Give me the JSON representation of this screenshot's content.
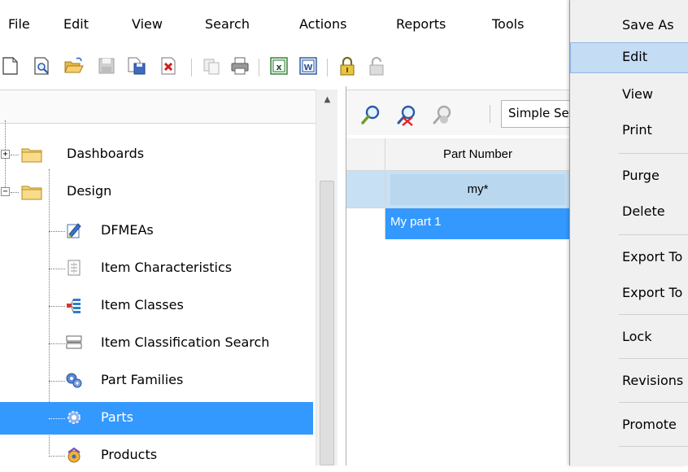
{
  "menubar": {
    "items": [
      "File",
      "Edit",
      "View",
      "Search",
      "Actions",
      "Reports",
      "Tools"
    ]
  },
  "toolbar": {
    "buttons": [
      "new-doc-icon",
      "print-preview-icon",
      "open-folder-icon",
      "save-icon",
      "save-as-icon",
      "delete-icon",
      "copy-icon",
      "print-icon",
      "excel-icon",
      "word-icon",
      "lock-icon",
      "unlock-icon"
    ]
  },
  "tree": {
    "items": [
      {
        "label": "Dashboards",
        "type": "folder",
        "expander": "+"
      },
      {
        "label": "Design",
        "type": "folder",
        "expander": "−"
      },
      {
        "label": "DFMEAs",
        "type": "leaf",
        "icon": "dfmea-icon"
      },
      {
        "label": "Item Characteristics",
        "type": "leaf",
        "icon": "characteristics-icon"
      },
      {
        "label": "Item Classes",
        "type": "leaf",
        "icon": "item-classes-icon"
      },
      {
        "label": "Item Classification Search",
        "type": "leaf",
        "icon": "classification-icon"
      },
      {
        "label": "Part Families",
        "type": "leaf",
        "icon": "part-families-icon"
      },
      {
        "label": "Parts",
        "type": "leaf",
        "icon": "parts-gear-icon",
        "selected": true
      },
      {
        "label": "Products",
        "type": "leaf",
        "icon": "products-icon"
      }
    ]
  },
  "grid": {
    "search_mode": "Simple Search",
    "column_header": "Part Number",
    "filter_value": "my*",
    "rows": [
      "My part 1"
    ]
  },
  "context_menu": {
    "items": [
      "Save As",
      "Edit",
      "View",
      "Print",
      "Purge",
      "Delete",
      "Export To",
      "Export To",
      "Lock",
      "Revisions",
      "Promote"
    ],
    "highlighted": "Edit"
  },
  "colors": {
    "selection": "#3399ff",
    "menu_highlight": "#c5dcf5",
    "filter_row": "#c7e0f4"
  }
}
